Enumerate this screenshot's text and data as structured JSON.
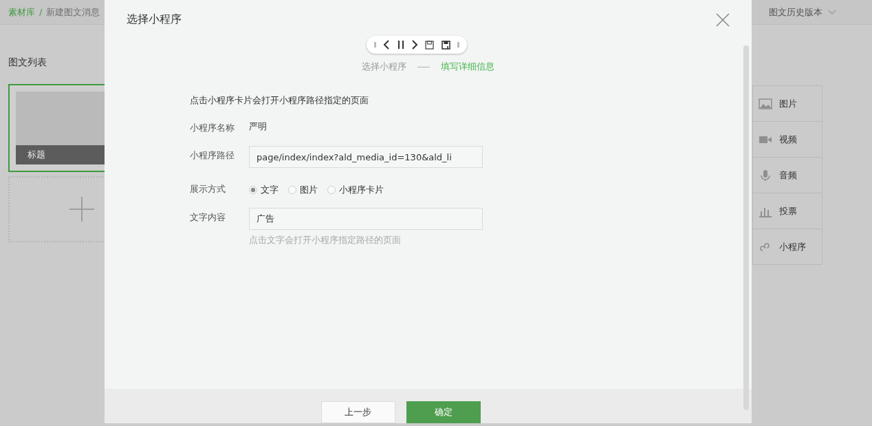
{
  "breadcrumb": {
    "separator": "/",
    "items": [
      {
        "label": "素材库",
        "kind": "link"
      },
      {
        "label": "新建图文消息",
        "kind": "current"
      }
    ]
  },
  "history_menu": {
    "label": "图文历史版本"
  },
  "article_list": {
    "title": "图文列表",
    "articles": [
      {
        "title": "标题",
        "selected": true
      }
    ]
  },
  "media_panel": {
    "items": [
      {
        "label": "图片",
        "kind": "image"
      },
      {
        "label": "视频",
        "kind": "video"
      },
      {
        "label": "音频",
        "kind": "audio"
      },
      {
        "label": "投票",
        "kind": "vote"
      },
      {
        "label": "小程序",
        "kind": "miniprogram"
      }
    ]
  },
  "modal": {
    "title": "选择小程序",
    "steps": [
      {
        "label": "选择小程序",
        "selected": false
      },
      {
        "label": "填写详细信息",
        "selected": true
      }
    ],
    "intro": "点击小程序卡片会打开小程序路径指定的页面",
    "fields": [
      {
        "label": "小程序名称",
        "kind": "static",
        "value": "严明"
      },
      {
        "label": "小程序路径",
        "kind": "input",
        "value": "page/index/index?ald_media_id=130&ald_li"
      },
      {
        "label": "展示方式",
        "kind": "radio",
        "options": [
          {
            "label": "文字",
            "selected": true
          },
          {
            "label": "图片",
            "selected": false
          },
          {
            "label": "小程序卡片",
            "selected": false
          }
        ]
      },
      {
        "label": "文字内容",
        "kind": "input",
        "value": "广告",
        "hint": "点击文字会打开小程序指定路径的页面"
      }
    ],
    "buttons": [
      {
        "label": "上一步",
        "kind": "secondary"
      },
      {
        "label": "确定",
        "kind": "primary"
      }
    ]
  }
}
